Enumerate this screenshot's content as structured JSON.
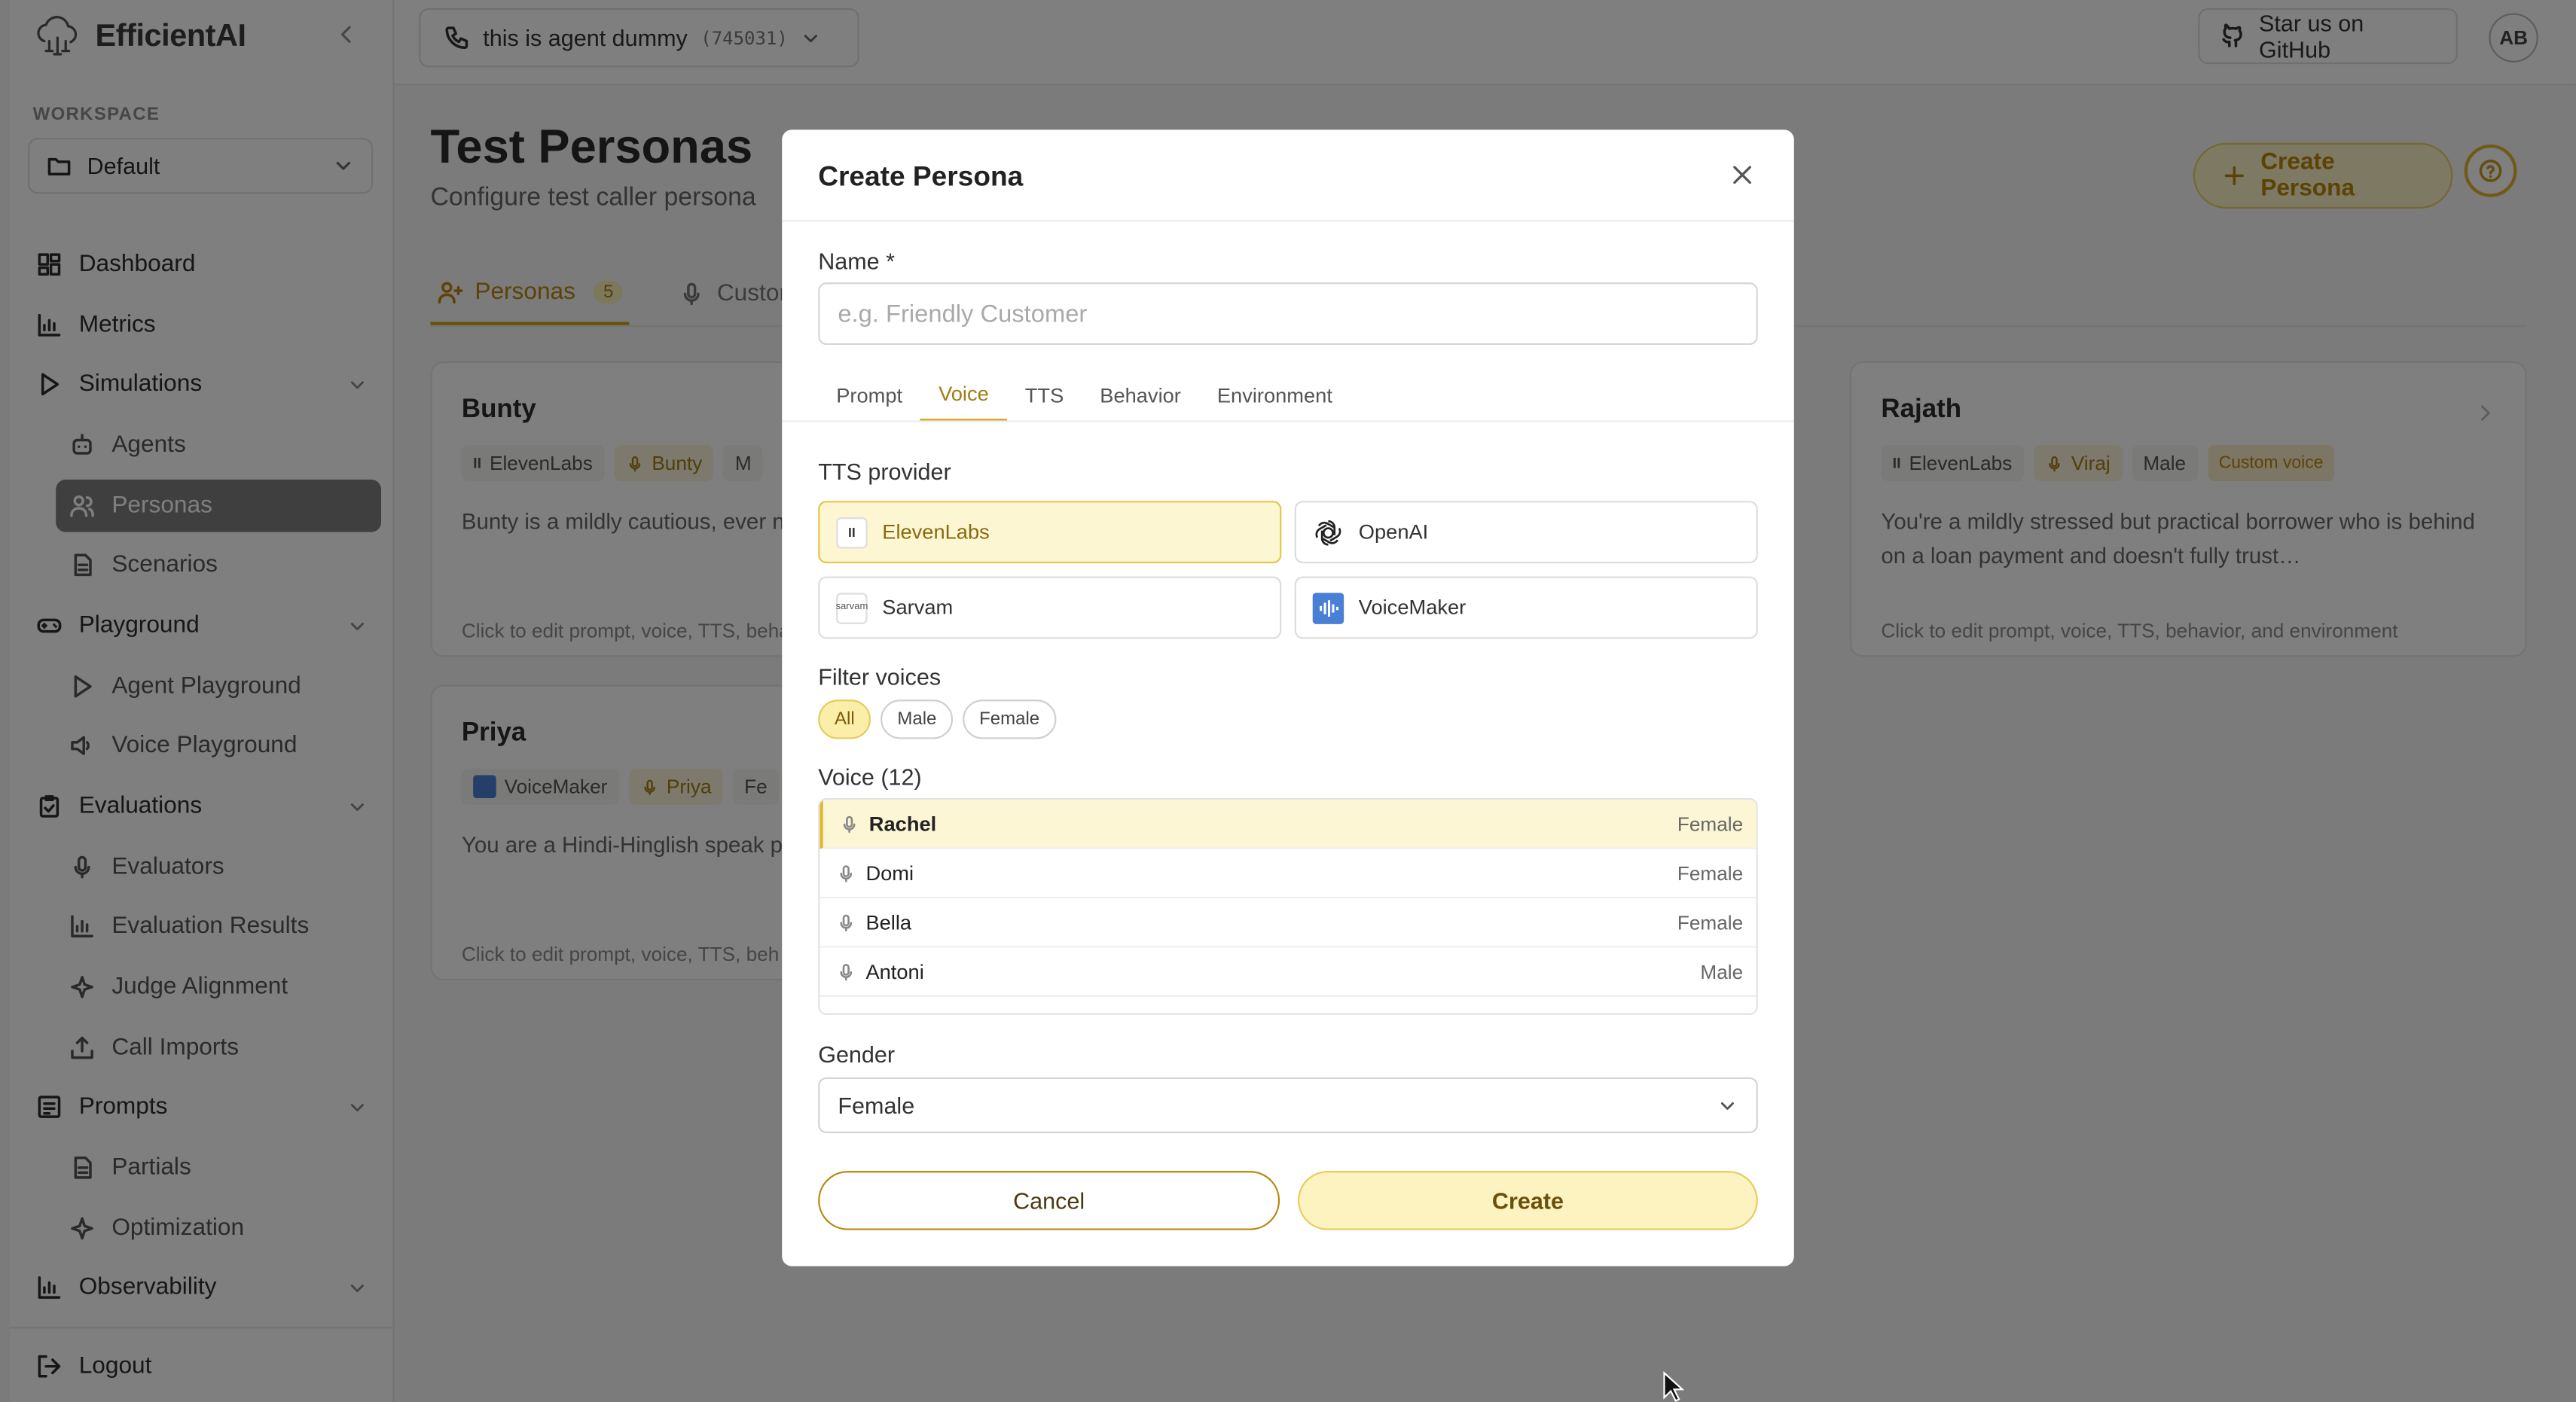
{
  "brand": {
    "name": "EfficientAI"
  },
  "workspace": {
    "label": "WORKSPACE",
    "selected": "Default"
  },
  "sidebar": {
    "items": [
      {
        "label": "Dashboard",
        "icon": "dashboard-icon"
      },
      {
        "label": "Metrics",
        "icon": "bar-chart-icon"
      },
      {
        "label": "Simulations",
        "icon": "play-icon",
        "expanded": true
      },
      {
        "label": "Agents",
        "icon": "bot-icon"
      },
      {
        "label": "Personas",
        "icon": "users-icon",
        "active": true
      },
      {
        "label": "Scenarios",
        "icon": "file-icon"
      },
      {
        "label": "Playground",
        "icon": "gamepad-icon",
        "expanded": true
      },
      {
        "label": "Agent Playground",
        "icon": "play-icon"
      },
      {
        "label": "Voice Playground",
        "icon": "speaker-icon"
      },
      {
        "label": "Evaluations",
        "icon": "clipboard-check-icon",
        "expanded": true
      },
      {
        "label": "Evaluators",
        "icon": "mic-icon"
      },
      {
        "label": "Evaluation Results",
        "icon": "bar-chart-icon"
      },
      {
        "label": "Judge Alignment",
        "icon": "sparkle-icon"
      },
      {
        "label": "Call Imports",
        "icon": "upload-icon"
      },
      {
        "label": "Prompts",
        "icon": "list-icon",
        "expanded": true
      },
      {
        "label": "Partials",
        "icon": "file-icon"
      },
      {
        "label": "Optimization",
        "icon": "sparkle-icon"
      },
      {
        "label": "Observability",
        "icon": "bar-chart-icon",
        "expanded": false
      },
      {
        "label": "Logout",
        "icon": "logout-icon"
      }
    ]
  },
  "topbar": {
    "agent_name": "this is agent dummy",
    "agent_code": "(745031)",
    "github_label": "Star us on GitHub",
    "avatar_initials": "AB"
  },
  "page": {
    "title": "Test Personas",
    "subtitle": "Configure test caller persona",
    "create_label": "Create Persona",
    "tabs": [
      {
        "label": "Personas",
        "count": "5",
        "active": true
      },
      {
        "label": "Custon",
        "active": false
      }
    ]
  },
  "cards": [
    {
      "name": "Bunty",
      "provider": "ElevenLabs",
      "voice": "Bunty",
      "gender_partial": "M",
      "desc": "Bunty is a mildly cautious, ever natural, informal, and a little g",
      "foot": "Click to edit prompt, voice, TTS, behav"
    },
    {
      "name": "Rajath",
      "provider": "ElevenLabs",
      "voice": "Viraj",
      "gender": "Male",
      "custom": "Custom voice",
      "desc": "You're a mildly stressed but practical borrower who is behind on a loan payment and doesn't fully trust…",
      "foot": "Click to edit prompt, voice, TTS, behavior, and environment"
    },
    {
      "name": "Priya",
      "provider": "VoiceMaker",
      "voice": "Priya",
      "gender_partial": "Fe",
      "desc": "You are a Hindi-Hinglish speak polite yet wary, using everyda",
      "foot": "Click to edit prompt, voice, TTS, beh"
    }
  ],
  "modal": {
    "title": "Create Persona",
    "name_label": "Name *",
    "name_placeholder": "e.g. Friendly Customer",
    "name_value": "",
    "tabs": [
      "Prompt",
      "Voice",
      "TTS",
      "Behavior",
      "Environment"
    ],
    "active_tab": "Voice",
    "tts_label": "TTS provider",
    "providers": [
      {
        "name": "ElevenLabs",
        "selected": true
      },
      {
        "name": "OpenAI",
        "selected": false
      },
      {
        "name": "Sarvam",
        "selected": false
      },
      {
        "name": "VoiceMaker",
        "selected": false
      }
    ],
    "sarvam_logo_text": "sarvam",
    "filter_label": "Filter voices",
    "filters": [
      {
        "label": "All",
        "selected": true
      },
      {
        "label": "Male",
        "selected": false
      },
      {
        "label": "Female",
        "selected": false
      }
    ],
    "voice_label": "Voice (12)",
    "voices": [
      {
        "name": "Rachel",
        "gender": "Female",
        "selected": true
      },
      {
        "name": "Domi",
        "gender": "Female"
      },
      {
        "name": "Bella",
        "gender": "Female"
      },
      {
        "name": "Antoni",
        "gender": "Male"
      }
    ],
    "gender_label": "Gender",
    "gender_value": "Female",
    "cancel_label": "Cancel",
    "create_label": "Create"
  },
  "colors": {
    "accent": "#d4a017",
    "accent_bg": "#fcf3c0",
    "overlay": "rgba(0,0,0,0.5)"
  }
}
